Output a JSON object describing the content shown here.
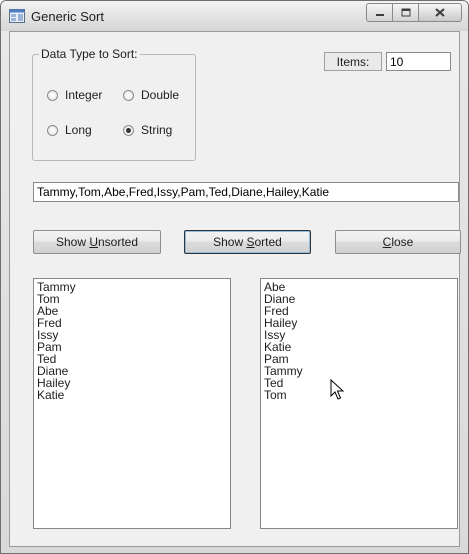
{
  "window": {
    "title": "Generic Sort",
    "caption_buttons": [
      "minimize-icon",
      "maximize-icon",
      "close-icon"
    ]
  },
  "data_type_group": {
    "legend": "Data Type to Sort:",
    "options": [
      {
        "label": "Integer",
        "checked": false
      },
      {
        "label": "Double",
        "checked": false
      },
      {
        "label": "Long",
        "checked": false
      },
      {
        "label": "String",
        "checked": true
      }
    ]
  },
  "items": {
    "label": "Items:",
    "value": "10"
  },
  "data_input": {
    "value": "Tammy,Tom,Abe,Fred,Issy,Pam,Ted,Diane,Hailey,Katie"
  },
  "buttons": {
    "show_unsorted": {
      "before": "Show ",
      "mnemonic": "U",
      "after": "nsorted"
    },
    "show_sorted": {
      "before": "Show ",
      "mnemonic": "S",
      "after": "orted"
    },
    "close": {
      "before": "",
      "mnemonic": "C",
      "after": "lose"
    }
  },
  "unsorted_list": [
    "Tammy",
    "Tom",
    "Abe",
    "Fred",
    "Issy",
    "Pam",
    "Ted",
    "Diane",
    "Hailey",
    "Katie"
  ],
  "sorted_list": [
    "Abe",
    "Diane",
    "Fred",
    "Hailey",
    "Issy",
    "Katie",
    "Pam",
    "Tammy",
    "Ted",
    "Tom"
  ]
}
